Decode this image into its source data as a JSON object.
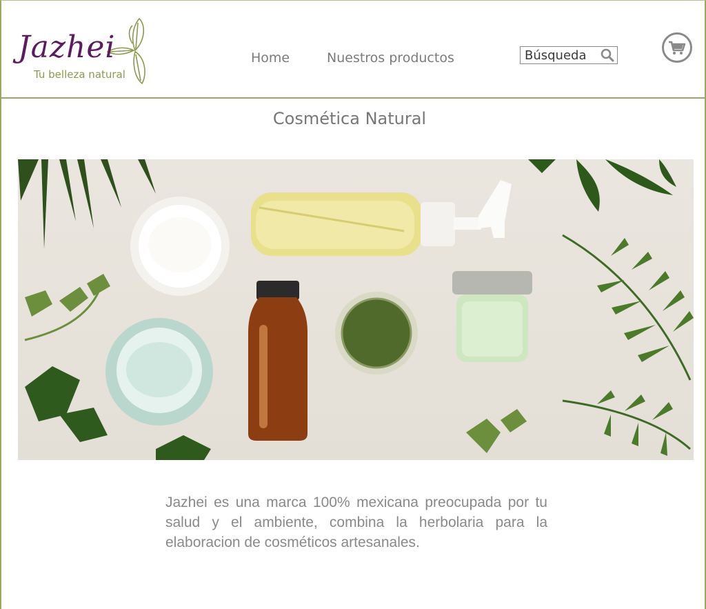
{
  "brand": {
    "name": "Jazhei",
    "tagline": "Tu belleza natural"
  },
  "nav": {
    "items": [
      {
        "label": "Home"
      },
      {
        "label": "Nuestros productos"
      }
    ]
  },
  "search": {
    "placeholder": "Búsqueda",
    "icon": "search-icon"
  },
  "cart": {
    "icon": "shopping-cart-icon"
  },
  "main": {
    "title": "Cosmética Natural",
    "intro": "Jazhei es una marca 100% mexicana preocupada por tu salud y el ambiente, combina la herbolaria para la elaboracion de cosméticos artesanales."
  },
  "colors": {
    "brand_purple": "#5d1a63",
    "brand_green": "#8c9a4e",
    "border_green": "#9aa865",
    "text_gray": "#8a8a8a"
  }
}
